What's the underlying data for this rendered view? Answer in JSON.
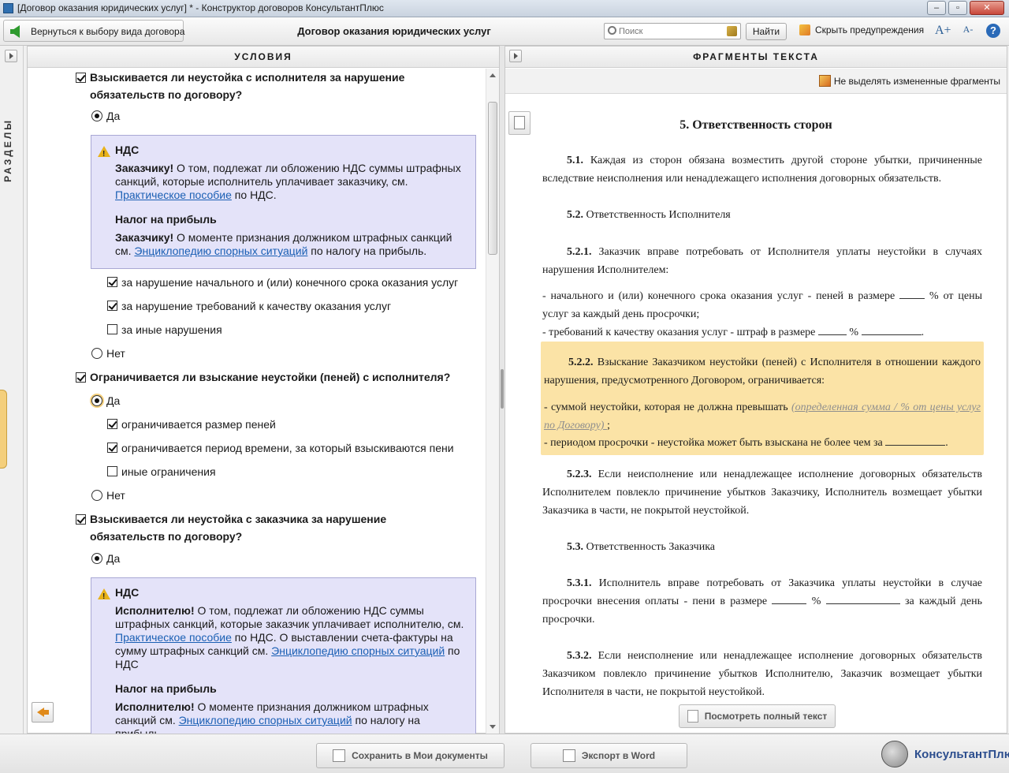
{
  "window": {
    "title": "[Договор оказания юридических услуг] * - Конструктор договоров КонсультантПлюс",
    "minimize": "–",
    "maximize": "▫",
    "close": "✕"
  },
  "toolbar": {
    "back_label": "Вернуться к выбору вида договора",
    "doc_title": "Договор оказания юридических услуг",
    "search_placeholder": "Поиск",
    "find_label": "Найти",
    "hide_warnings_label": "Скрыть предупреждения",
    "font_up": "A+",
    "font_down": "A-",
    "help": "?"
  },
  "left_rail": {
    "label": "РАЗДЕЛЫ"
  },
  "conditions": {
    "header": "УСЛОВИЯ",
    "q1": {
      "text": "Взыскивается ли неустойка с исполнителя за нарушение обязательств по договору?",
      "yes": "Да",
      "note": {
        "h1": "НДС",
        "p1_bold": "Заказчику!",
        "p1_text": " О том, подлежат ли обложению НДС суммы штрафных санкций, которые исполнитель уплачивает заказчику, см. ",
        "p1_link": "Практическое пособие",
        "p1_tail": " по НДС.",
        "h2": "Налог на прибыль",
        "p2_bold": "Заказчику!",
        "p2_text": " О моменте признания должником штрафных санкций см. ",
        "p2_link": "Энциклопедию спорных ситуаций",
        "p2_tail": " по налогу на прибыль."
      },
      "opt1": "за нарушение начального и (или) конечного срока оказания услуг",
      "opt2": "за нарушение требований к качеству оказания услуг",
      "opt3": "за иные нарушения",
      "no": "Нет"
    },
    "q2": {
      "text": "Ограничивается ли взыскание неустойки (пеней) с исполнителя?",
      "yes": "Да",
      "opt1": "ограничивается размер пеней",
      "opt2": "ограничивается период времени, за который взыскиваются пени",
      "opt3": "иные ограничения",
      "no": "Нет"
    },
    "q3": {
      "text": "Взыскивается ли неустойка с заказчика за нарушение обязательств по договору?",
      "yes": "Да",
      "note": {
        "h1": "НДС",
        "p1_bold": "Исполнителю!",
        "p1_text": " О том, подлежат ли обложению НДС суммы штрафных санкций, которые заказчик уплачивает исполнителю, см. ",
        "p1_link": "Практическое пособие",
        "p1_mid": " по НДС. О выставлении счета-фактуры на сумму штрафных санкций см. ",
        "p1_link2": "Энциклопедию спорных ситуаций",
        "p1_tail": " по НДС",
        "h2": "Налог на прибыль",
        "p2_bold": "Исполнителю!",
        "p2_text": " О моменте признания должником штрафных санкций см. ",
        "p2_link": "Энциклопедию спорных ситуаций",
        "p2_tail": " по налогу на прибыль."
      }
    }
  },
  "fragments": {
    "header": "ФРАГМЕНТЫ ТЕКСТА",
    "no_highlight_label": "Не выделять измененные фрагменты",
    "section_title": "5.  Ответственность сторон",
    "p5_1_num": "5.1.",
    "p5_1": " Каждая из сторон обязана возместить другой стороне убытки, причиненные вследствие неисполнения или ненадлежащего исполнения договорных обязательств.",
    "p5_2_num": "5.2.",
    "p5_2": " Ответственность Исполнителя",
    "p5_2_1_num": "5.2.1.",
    "p5_2_1": " Заказчик вправе потребовать от Исполнителя уплаты неустойки в случаях нарушения Исполнителем:",
    "li1_a": "-  начального и (или) конечного срока оказания услуг - пеней в размере ",
    "li1_b": " % от цены услуг за каждый день просрочки;",
    "li2_a": "-  требований к качеству оказания услуг - штраф в размере ",
    "li2_b": " % ",
    "li2_c": ".",
    "p5_2_2_num": "5.2.2.",
    "p5_2_2": " Взыскание Заказчиком неустойки (пеней) с Исполнителя в отношении каждого нарушения, предусмотренного Договором, ограничивается:",
    "li3_a": "-  суммой неустойки, которая не должна превышать ",
    "li3_placeholder": "    (определенная сумма / % от цены услуг по Договору)    ",
    "li3_b": ";",
    "li4_a": "-  периодом просрочки - неустойка может быть взыскана не более чем за ",
    "li4_b": ".",
    "p5_2_3_num": "5.2.3.",
    "p5_2_3": " Если неисполнение или ненадлежащее исполнение договорных обязательств Исполнителем повлекло причинение убытков Заказчику, Исполнитель возмещает убытки Заказчика в части, не покрытой неустойкой.",
    "p5_3_num": "5.3.",
    "p5_3": " Ответственность Заказчика",
    "p5_3_1_num": "5.3.1.",
    "p5_3_1_a": " Исполнитель вправе потребовать от Заказчика уплаты неустойки в случае просрочки внесения оплаты - пени в размере ",
    "p5_3_1_b": " % ",
    "p5_3_1_c": " за каждый день просрочки.",
    "p5_3_2_num": "5.3.2.",
    "p5_3_2": " Если неисполнение или ненадлежащее исполнение договорных обязательств Заказчиком повлекло причинение убытков Исполнителю, Заказчик возмещает убытки Исполнителя в части, не покрытой неустойкой.",
    "full_text_label": "Посмотреть полный текст"
  },
  "bottom": {
    "save_label": "Сохранить в Мои документы",
    "export_label": "Экспорт в Word",
    "logo_text": "КонсультантПлюс"
  },
  "colors": {
    "note_bg": "#e4e3f9",
    "highlight_bg": "#fbe3a6",
    "link": "#1a5fb4"
  }
}
